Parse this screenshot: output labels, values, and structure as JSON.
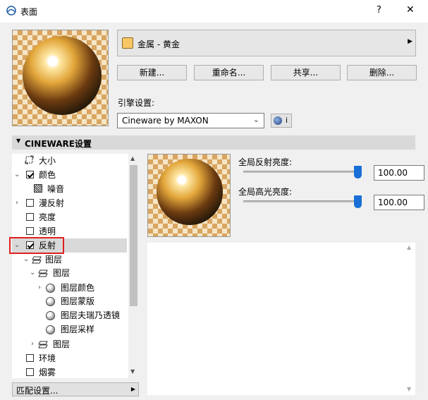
{
  "window": {
    "title": "表面",
    "help_label": "?",
    "close_label": "✕"
  },
  "material": {
    "name": "金属 - 黄金",
    "swatch_color": "#f7c766"
  },
  "buttons": {
    "new": "新建...",
    "rename": "重命名...",
    "share": "共享...",
    "delete": "删除..."
  },
  "engine": {
    "label": "引擎设置:",
    "value": "Cineware by MAXON",
    "info": "i"
  },
  "section": {
    "title": "CINEWARE设置"
  },
  "tree": [
    {
      "label": "大小"
    },
    {
      "label": "颜色"
    },
    {
      "label": "噪音"
    },
    {
      "label": "漫反射"
    },
    {
      "label": "亮度"
    },
    {
      "label": "透明"
    },
    {
      "label": "反射"
    },
    {
      "label": "图层"
    },
    {
      "label": "图层"
    },
    {
      "label": "图层颜色"
    },
    {
      "label": "图层蒙版"
    },
    {
      "label": "图层夫瑞乃透镜"
    },
    {
      "label": "图层采样"
    },
    {
      "label": "图层"
    },
    {
      "label": "环境"
    },
    {
      "label": "烟雾"
    }
  ],
  "params": {
    "reflection_label": "全局反射亮度:",
    "reflection_value": "100.00",
    "reflection_level": 1.0,
    "highlight_label": "全局高光亮度:",
    "highlight_value": "100.00",
    "highlight_level": 1.0
  },
  "footer": {
    "match_settings": "匹配设置..."
  },
  "colors": {
    "accent": "#1a6fd6",
    "highlight_box": "#e02020",
    "selected_row": "#d9d9d9"
  }
}
